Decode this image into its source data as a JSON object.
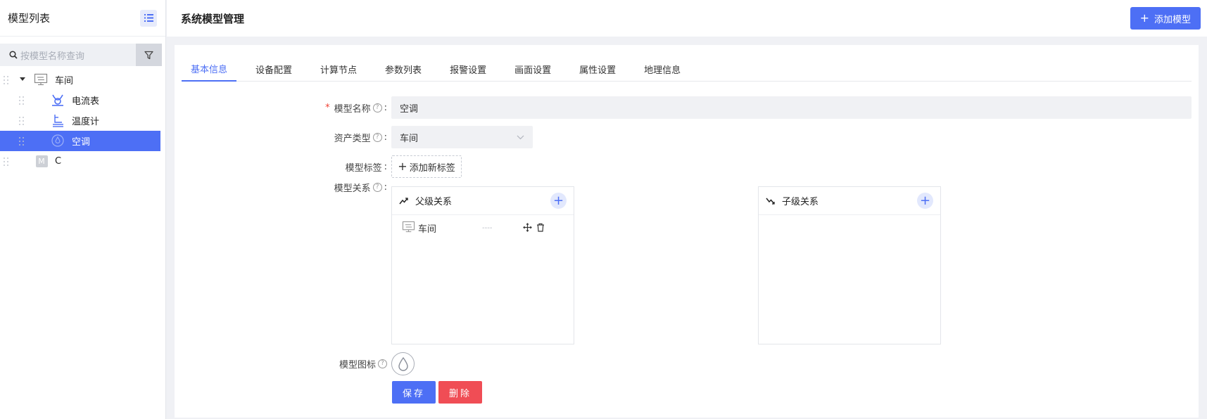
{
  "sidebar": {
    "title": "模型列表",
    "search_placeholder": "按模型名称查询",
    "tree": [
      {
        "label": "车间",
        "icon": "workshop-icon"
      },
      {
        "label": "电流表",
        "icon": "ammeter-icon"
      },
      {
        "label": "温度计",
        "icon": "thermometer-icon"
      },
      {
        "label": "空调",
        "icon": "air-conditioner-icon",
        "selected": true
      },
      {
        "label": "C",
        "badge": "M"
      }
    ]
  },
  "header": {
    "title": "系统模型管理",
    "add_button": "添加模型"
  },
  "tabs": [
    "基本信息",
    "设备配置",
    "计算节点",
    "参数列表",
    "报警设置",
    "画面设置",
    "属性设置",
    "地理信息"
  ],
  "form": {
    "name_label": "模型名称",
    "name_value": "空调",
    "type_label": "资产类型",
    "type_value": "车间",
    "tag_label": "模型标签",
    "add_tag": "添加新标签",
    "relation_label": "模型关系",
    "parent_title": "父级关系",
    "child_title": "子级关系",
    "parent_items": [
      {
        "name": "车间",
        "extra": "----"
      }
    ],
    "icon_label": "模型图标",
    "save": "保存",
    "delete": "删除"
  },
  "colors": {
    "accent": "#4d6ff5",
    "danger": "#f04d55",
    "required": "#f04134"
  }
}
